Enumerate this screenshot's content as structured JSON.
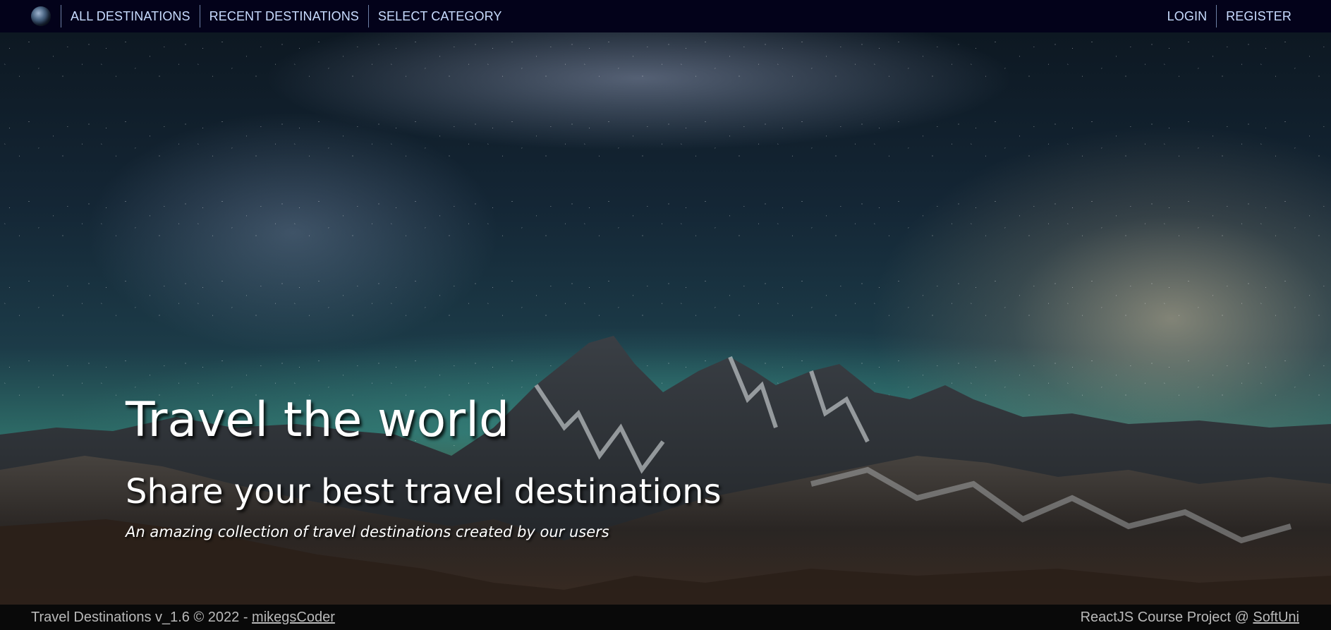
{
  "navbar": {
    "logo_icon": "globe-icon",
    "left_links": [
      {
        "label": "ALL DESTINATIONS"
      },
      {
        "label": "RECENT DESTINATIONS"
      },
      {
        "label": "SELECT CATEGORY"
      }
    ],
    "right_links": [
      {
        "label": "LOGIN"
      },
      {
        "label": "REGISTER"
      }
    ],
    "colors": {
      "background": "#03021a",
      "link": "#c9ddff"
    }
  },
  "hero": {
    "title": "Travel the world",
    "subtitle": "Share your best travel destinations",
    "tagline": "An amazing collection of travel destinations created by our users",
    "background_image": "milky-way-over-mountains-night-sky"
  },
  "footer": {
    "left_text": "Travel Destinations v_1.6 © 2022 - ",
    "left_link": "mikegsCoder",
    "right_text": "ReactJS Course Project @ ",
    "right_link": "SoftUni",
    "colors": {
      "background": "#090909",
      "text": "#b9b9b9"
    }
  }
}
